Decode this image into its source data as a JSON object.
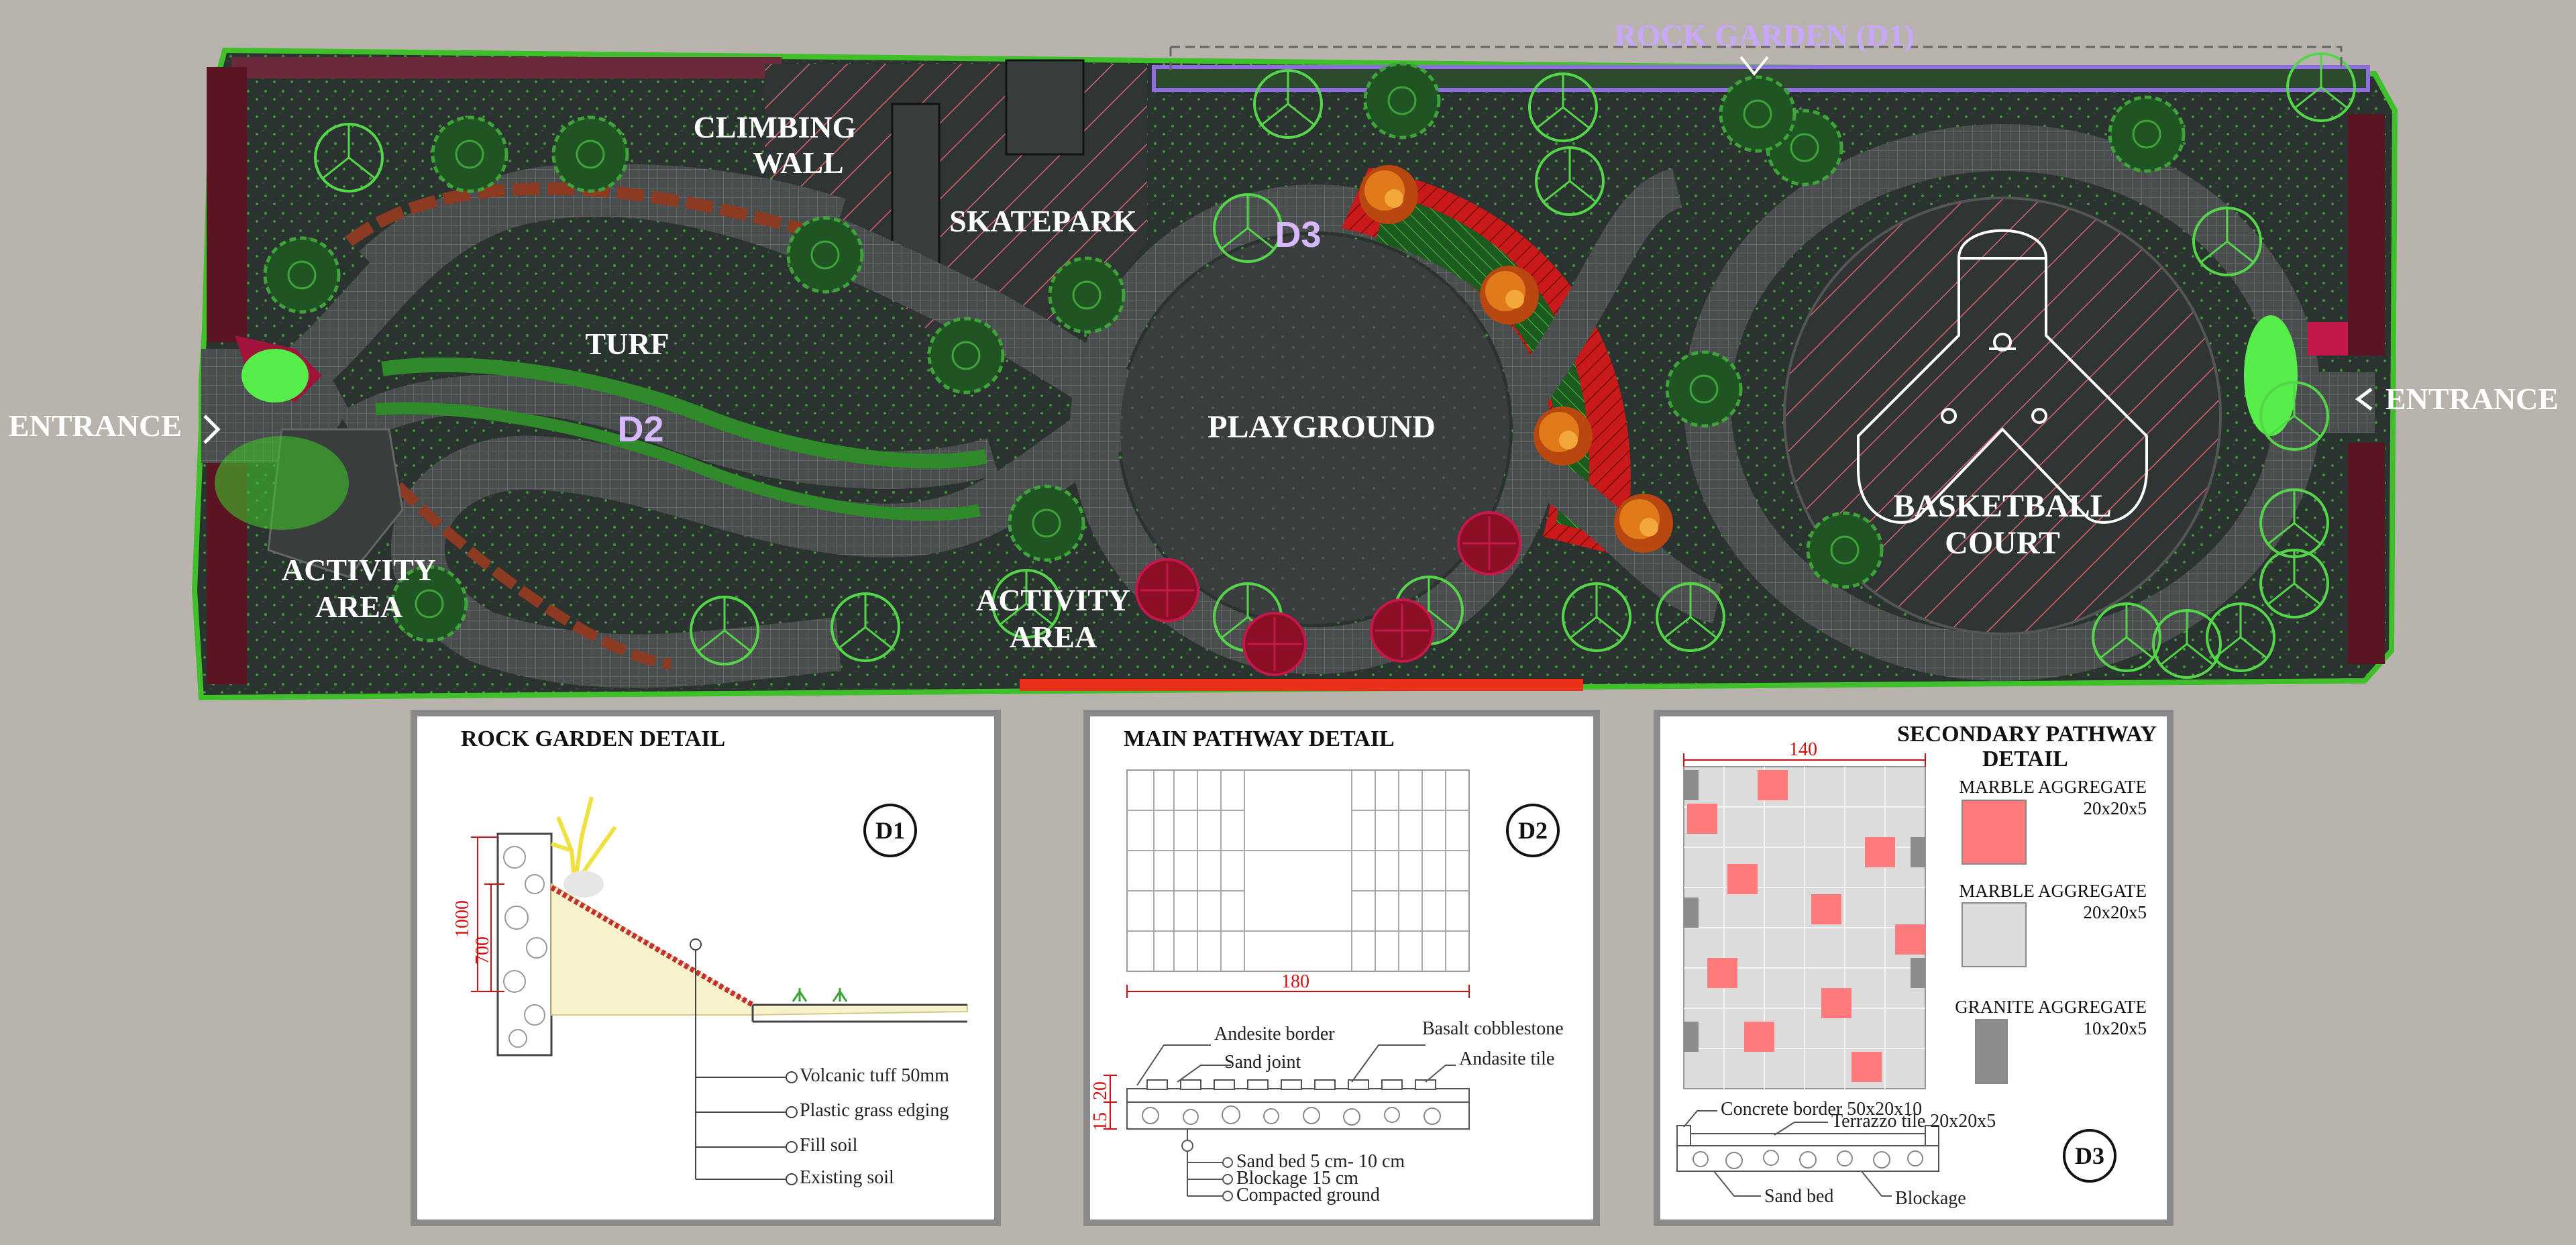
{
  "colors": {
    "background": "#b9b3ae",
    "site_fill": "#2b3330",
    "path_fill": "#4a4d4d",
    "hatch_red": "#e0606a",
    "border_green": "#3fbf2a",
    "label_purple": "#c9a6ff",
    "dim_red": "#d01010",
    "tile_pink": "#ff7a7a",
    "tile_light": "#dcdcdc",
    "tile_dark": "#8c8c8c"
  },
  "plan": {
    "rock_garden_label": "ROCK GARDEN (D1)",
    "climbing_wall_line1": "CLIMBING",
    "climbing_wall_line2": "WALL",
    "skatepark": "SKATEPARK",
    "turf": "TURF",
    "playground": "PLAYGROUND",
    "basketball_line1": "BASKETBALL",
    "basketball_line2": "COURT",
    "entrance_left": "ENTRANCE",
    "entrance_right": "ENTRANCE",
    "activity_left_line1": "ACTIVITY",
    "activity_left_line2": "AREA",
    "activity_mid_line1": "ACTIVITY",
    "activity_mid_line2": "AREA",
    "marker_d2": "D2",
    "marker_d3": "D3"
  },
  "detail_d1": {
    "title": "ROCK GARDEN DETAIL",
    "tag": "D1",
    "dim_1000": "1000",
    "dim_700": "700",
    "notes": [
      "Volcanic tuff 50mm",
      "Plastic grass edging",
      "Fill soil",
      "Existing soil"
    ]
  },
  "detail_d2": {
    "title": "MAIN PATHWAY DETAIL",
    "tag": "D2",
    "dim_180": "180",
    "dim_15": "15",
    "dim_20": "20",
    "label_andesite_border": "Andesite border",
    "label_sand_joint": "Sand joint",
    "label_basalt": "Basalt cobblestone",
    "label_andesite_tile": "Andasite tile",
    "notes": [
      "Sand bed 5 cm- 10 cm",
      "Blockage 15 cm",
      "Compacted ground"
    ]
  },
  "detail_d3": {
    "title_line1": "SECONDARY PATHWAY",
    "title_line2": "DETAIL",
    "tag": "D3",
    "dim_140": "140",
    "legend": [
      {
        "name": "MARBLE AGGREGATE",
        "size": "20x20x5"
      },
      {
        "name": "MARBLE AGGREGATE",
        "size": "20x20x5"
      },
      {
        "name": "GRANITE AGGREGATE",
        "size": "10x20x5"
      }
    ],
    "label_concrete_border": "Concrete border 50x20x10",
    "label_terrazzo": "Terrazzo tile 20x20x5",
    "label_sand_bed": "Sand bed",
    "label_blockage": "Blockage"
  }
}
